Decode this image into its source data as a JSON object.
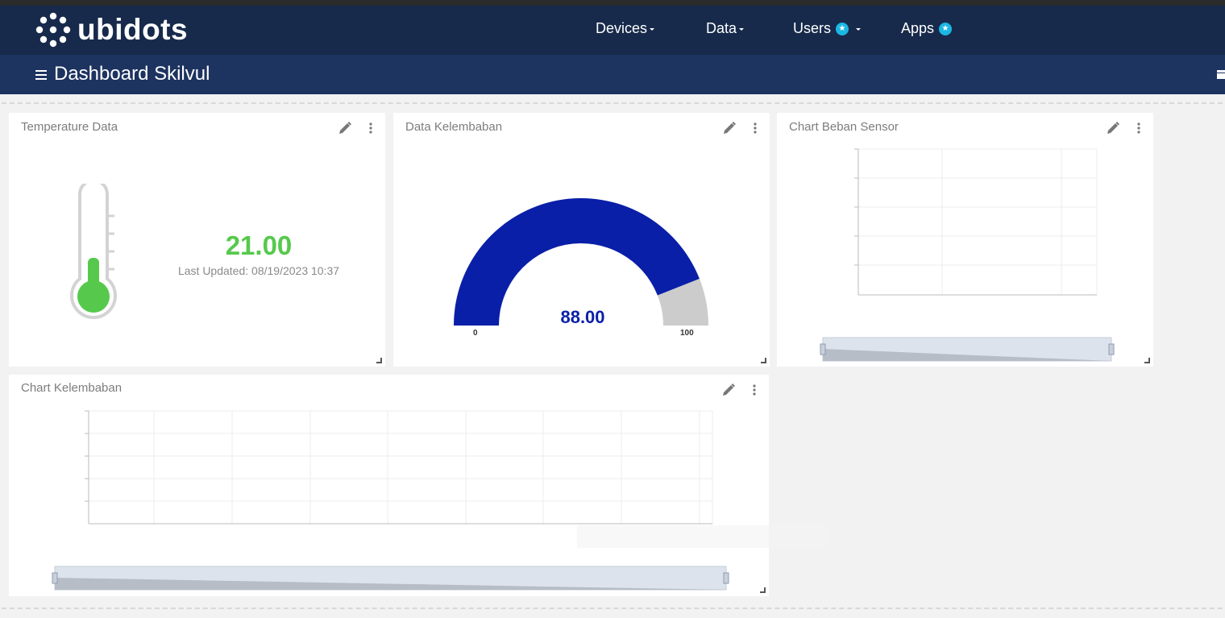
{
  "brand": {
    "name": "ubidots"
  },
  "nav": {
    "devices": "Devices",
    "data": "Data",
    "users": "Users",
    "apps": "Apps"
  },
  "dashboard": {
    "title": "Dashboard Skilvul"
  },
  "widgets": {
    "temperature": {
      "title": "Temperature Data",
      "value": "21.00",
      "updated": "Last Updated: 08/19/2023 10:37",
      "color": "#56c94c"
    },
    "humidity_gauge": {
      "title": "Data Kelembaban",
      "value": "88.00",
      "min": "0",
      "max": "100",
      "fraction": 0.88,
      "color": "#0a1fa8"
    },
    "load_chart": {
      "title": "Chart Beban Sensor"
    },
    "humidity_chart": {
      "title": "Chart Kelembaban"
    }
  },
  "colors": {
    "navbar": "#172a4b",
    "subbar": "#1d3360",
    "accent": "#1bb7e3"
  }
}
